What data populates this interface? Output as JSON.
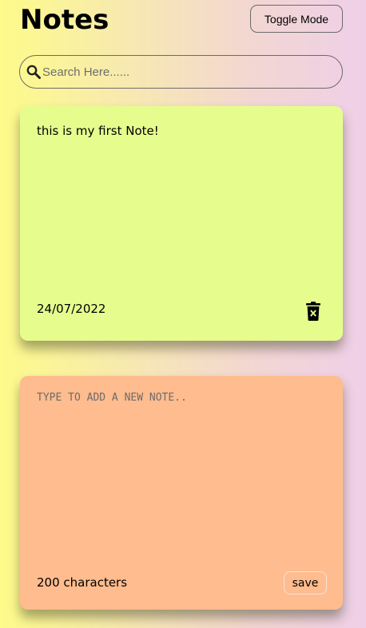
{
  "header": {
    "title": "Notes",
    "toggle_label": "Toggle Mode"
  },
  "search": {
    "placeholder": "Search Here......",
    "icon": "search-icon"
  },
  "notes": [
    {
      "text": "this is my first Note!",
      "date": "24/07/2022",
      "color": "#e6fd8e",
      "delete_icon": "trash-icon"
    }
  ],
  "new_note": {
    "placeholder": "TYPE TO ADD A NEW NOTE..",
    "characters_remaining": "200 characters",
    "save_label": "save",
    "color": "#ffbc8e"
  },
  "background_colors": [
    "#fdfb8a",
    "#f7e6b6",
    "#efcfe8"
  ]
}
